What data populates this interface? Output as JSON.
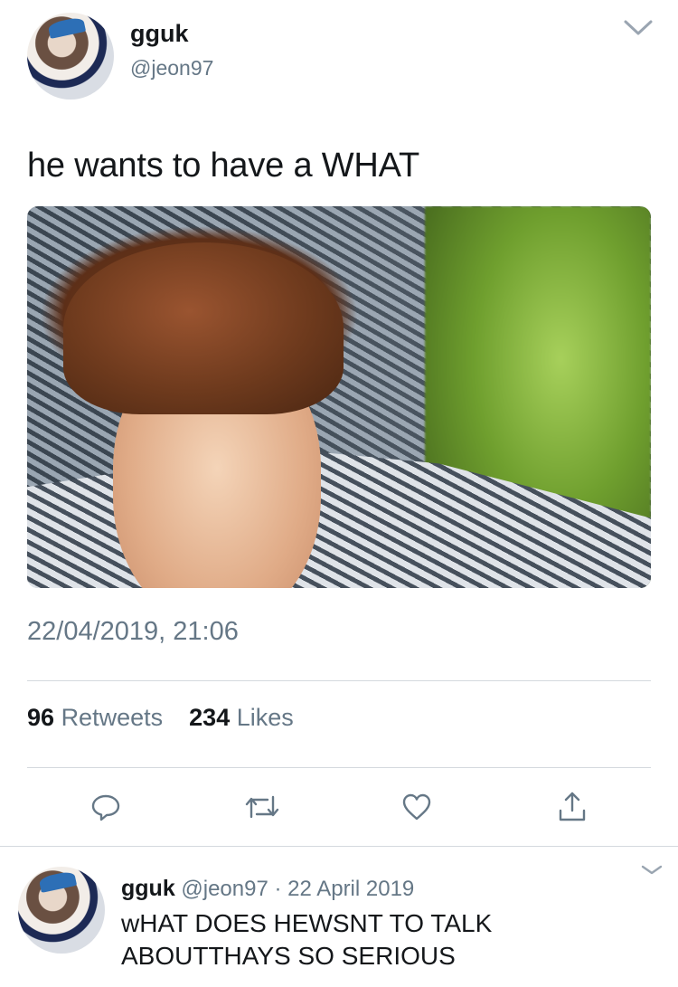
{
  "tweet": {
    "display_name": "gguk",
    "handle": "@jeon97",
    "text": "he wants to have a WHAT",
    "timestamp": "22/04/2019, 21:06",
    "retweets_count": "96",
    "retweets_label": "Retweets",
    "likes_count": "234",
    "likes_label": "Likes"
  },
  "reply": {
    "display_name": "gguk",
    "handle": "@jeon97",
    "separator": "·",
    "date": "22 April 2019",
    "text_lines": [
      "wHAT DOES HEWSNT TO TALK",
      "ABOUTTHAYS SO SERIOUS"
    ]
  },
  "icons": [
    "chevron-down-icon",
    "reply-icon",
    "retweet-icon",
    "like-icon",
    "share-icon"
  ],
  "colors": {
    "text": "#14171a",
    "secondary": "#657786",
    "divider": "#d4d9de",
    "icon": "#657786"
  }
}
